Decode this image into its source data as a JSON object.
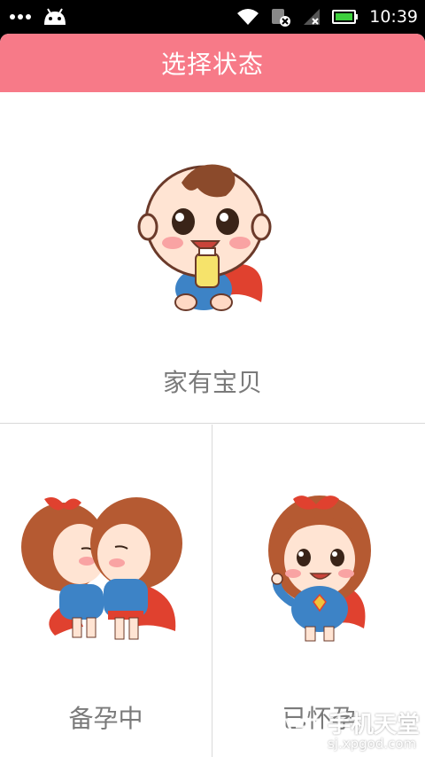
{
  "status_bar": {
    "time": "10:39",
    "icons": [
      "more-dots-icon",
      "android-icon",
      "wifi-icon",
      "sim-card-icon",
      "signal-icon",
      "battery-icon"
    ]
  },
  "header": {
    "title": "选择状态"
  },
  "options": [
    {
      "label": "家有宝贝",
      "illustration": "baby-with-bottle"
    },
    {
      "label": "备孕中",
      "illustration": "kissing-couple"
    },
    {
      "label": "已怀孕",
      "illustration": "pregnant-girl"
    }
  ],
  "watermark": {
    "brand": "手机天堂",
    "url": "sj.xpgod.com"
  },
  "colors": {
    "header_bg": "#f77a88",
    "label_text": "#7a7a7a",
    "divider": "#d9d9d9"
  }
}
